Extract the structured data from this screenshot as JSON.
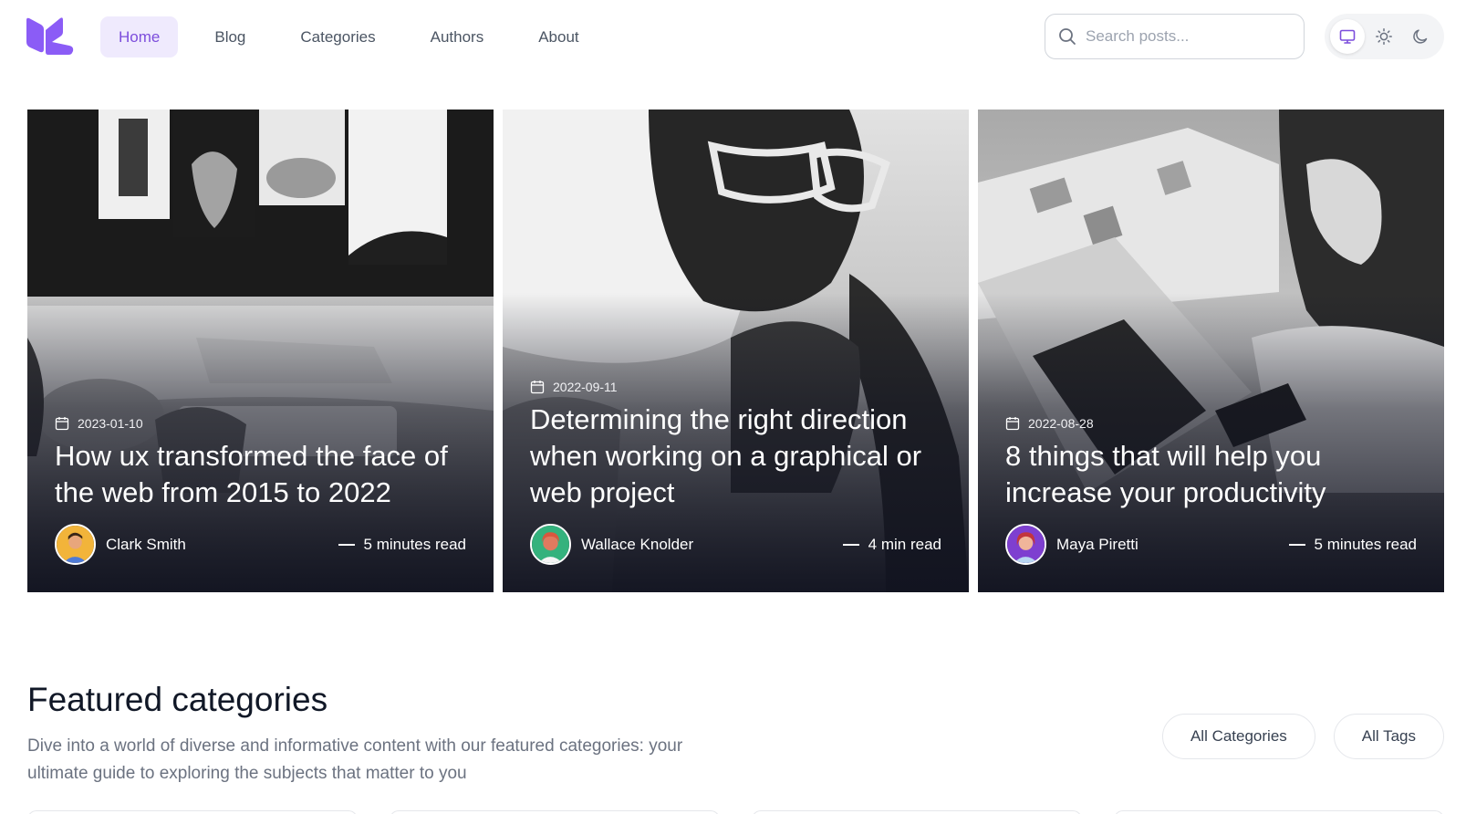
{
  "header": {
    "nav": [
      {
        "label": "Home",
        "active": true
      },
      {
        "label": "Blog"
      },
      {
        "label": "Categories"
      },
      {
        "label": "Authors"
      },
      {
        "label": "About"
      }
    ],
    "search": {
      "placeholder": "Search posts..."
    },
    "theme": {
      "options": [
        "monitor-icon",
        "sun-icon",
        "moon-icon"
      ],
      "active": "monitor-icon"
    },
    "accent": "#7c4ddc"
  },
  "posts": [
    {
      "date": "2023-01-10",
      "title": "How ux transformed the face of the web from 2015 to 2022",
      "author": "Clark Smith",
      "read_time": "5 minutes read"
    },
    {
      "date": "2022-09-11",
      "title": "Determining the right direction when working on a graphical or web project",
      "author": "Wallace Knolder",
      "read_time": "4 min read"
    },
    {
      "date": "2022-08-28",
      "title": "8 things that will help you increase your productivity",
      "author": "Maya Piretti",
      "read_time": "5 minutes read"
    }
  ],
  "featured": {
    "title": "Featured categories",
    "description": "Dive into a world of diverse and informative content with our featured categories: your ultimate guide to exploring the subjects that matter to you",
    "buttons": {
      "all_categories": "All Categories",
      "all_tags": "All Tags"
    }
  }
}
